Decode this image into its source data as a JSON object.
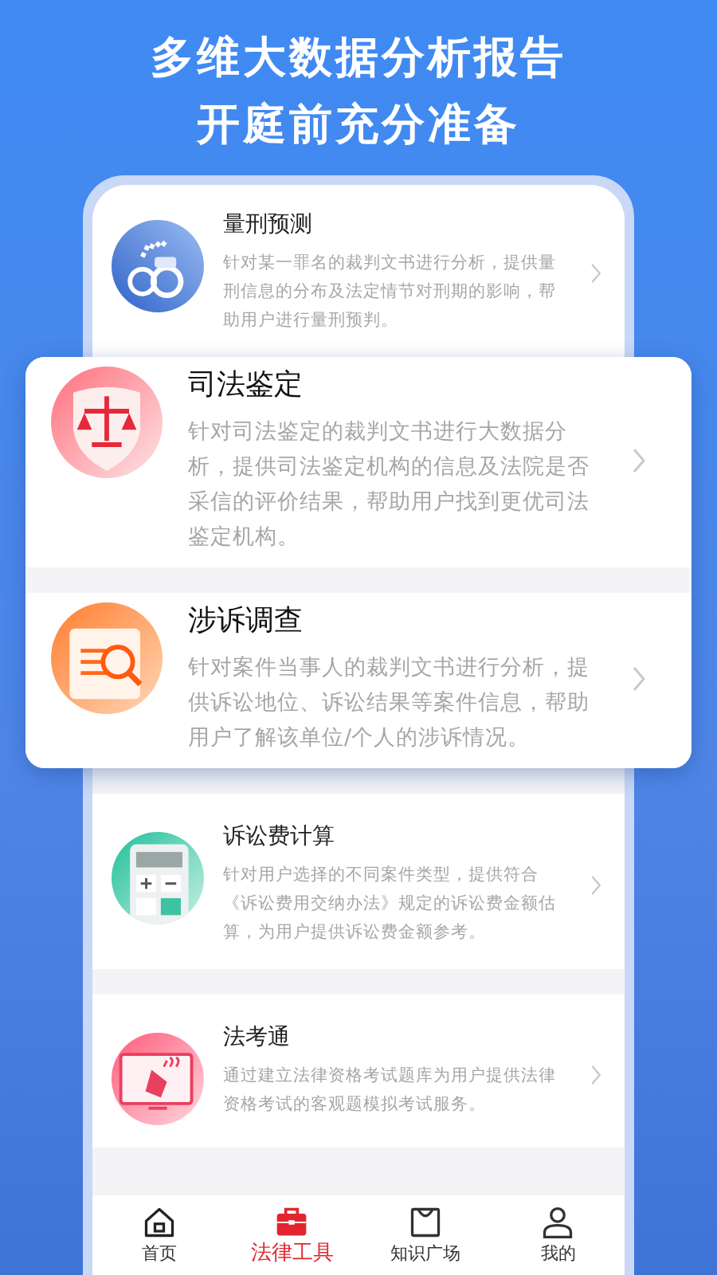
{
  "headline": [
    "多维大数据分析报告",
    "开庭前充分准备"
  ],
  "tools": [
    {
      "kind": "normal",
      "title": "量刑预测",
      "description": "针对某一罪名的裁判文书进行分析，提供量刑信息的分布及法定情节对刑期的影响，帮助用户进行量刑预判。"
    },
    {
      "kind": "featured",
      "title": "司法鉴定",
      "description": "针对司法鉴定的裁判文书进行大数据分析，提供司法鉴定机构的信息及法院是否采信的评价结果，帮助用户找到更优司法鉴定机构。"
    },
    {
      "kind": "featured",
      "title": "涉诉调查",
      "description": "针对案件当事人的裁判文书进行分析，提供诉讼地位、诉讼结果等案件信息，帮助用户了解该单位/个人的涉诉情况。"
    },
    {
      "kind": "normal",
      "title": "诉讼费计算",
      "description": "针对用户选择的不同案件类型，提供符合《诉讼费用交纳办法》规定的诉讼费金额估算，为用户提供诉讼费金额参考。"
    },
    {
      "kind": "normal",
      "title": "法考通",
      "description": "通过建立法律资格考试题库为用户提供法律资格考试的客观题模拟考试服务。"
    }
  ],
  "tab_bar": [
    {
      "label": "首页",
      "selected": false
    },
    {
      "label": "法律工具",
      "selected": true
    },
    {
      "label": "知识广场",
      "selected": false
    },
    {
      "label": "我的",
      "selected": false
    }
  ]
}
